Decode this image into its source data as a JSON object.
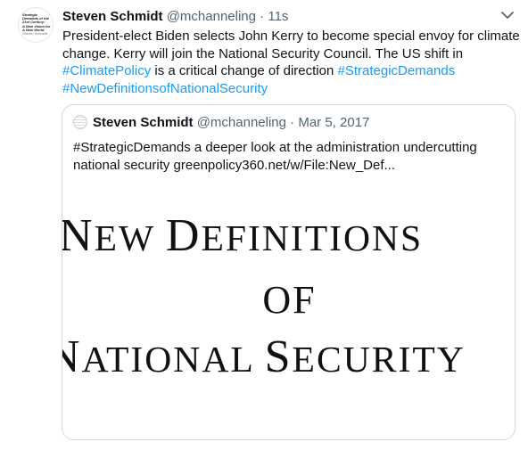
{
  "tweet": {
    "avatar_text": [
      "Strategic",
      "Demands of the",
      "21st Century:",
      "A New Vision for",
      "A New World"
    ],
    "avatar_subtext": [
      "Steven Schmidt"
    ],
    "author_name": "Steven Schmidt",
    "handle": "@mchanneling",
    "separator": "·",
    "time": "11s",
    "body": {
      "line1": "President-elect Biden selects John Kerry to become special envoy for climate",
      "line2": "change. Kerry will join the National Security Council. The US shift in",
      "hashtag1": "#ClimatePolicy",
      "mid_text": " is a critical change of direction ",
      "hashtag2": "#StrategicDemands",
      "hashtag3": "#NewDefinitionsofNationalSecurity"
    }
  },
  "quote": {
    "author_name": "Steven Schmidt",
    "handle": "@mchanneling",
    "separator": "·",
    "date": "Mar 5, 2017",
    "line1": "#StrategicDemands a deeper look at the administration undercutting",
    "line2": "national security greenpolicy360.net/w/File:New_Def..."
  },
  "image": {
    "line1_big": "N",
    "line1_small": "EW ",
    "line1_big2": "D",
    "line1_small2": "EFINITIONS",
    "line2": "OF",
    "line3_big": "N",
    "line3_small": "ATIONAL ",
    "line3_big2": "S",
    "line3_small2": "ECURITY"
  }
}
